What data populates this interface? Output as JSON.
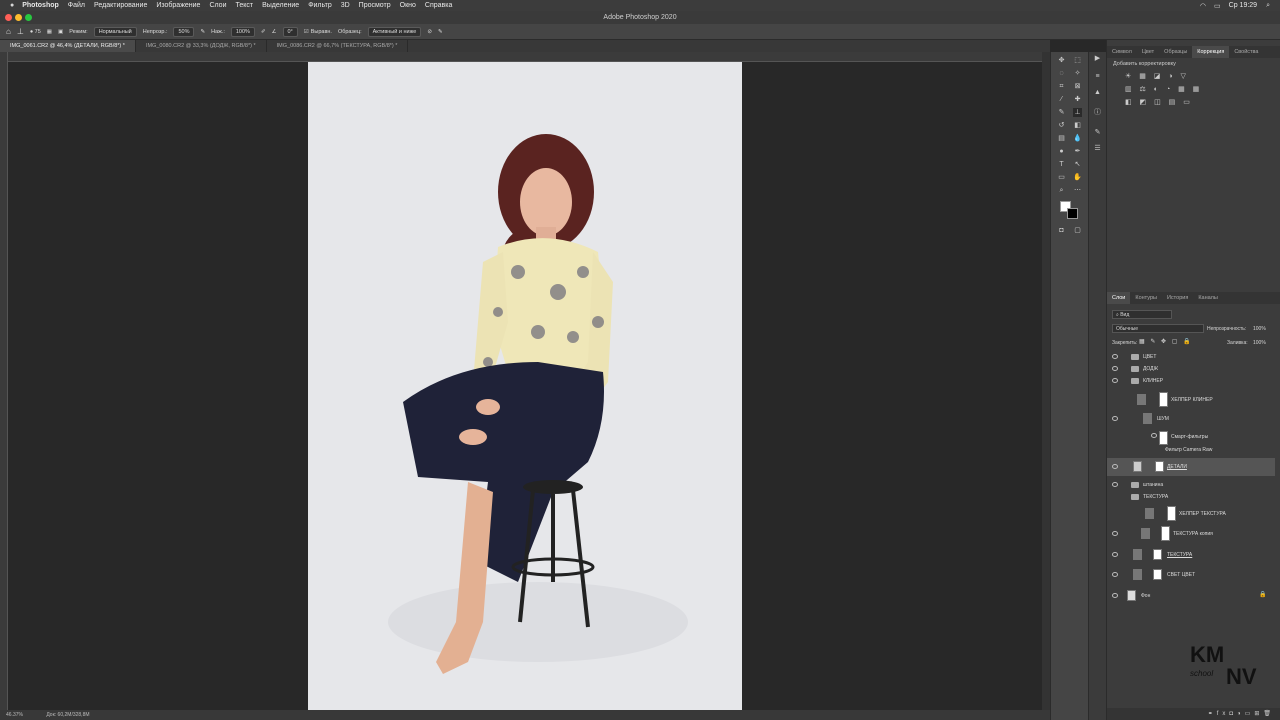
{
  "menubar": {
    "items": [
      "Photoshop",
      "Файл",
      "Редактирование",
      "Изображение",
      "Слои",
      "Текст",
      "Выделение",
      "Фильтр",
      "3D",
      "Просмотр",
      "Окно",
      "Справка"
    ],
    "clock": "Ср 19:29"
  },
  "title": "Adobe Photoshop 2020",
  "options": {
    "mode_label": "Режим:",
    "mode_value": "Нормальный",
    "opacity_label": "Непрозр.:",
    "opacity_value": "50%",
    "pressure_label": "Наж.:",
    "pressure_value": "100%",
    "angle_value": "0°",
    "aligned_label": "Выравн.",
    "sample_label": "Образец:",
    "sample_value": "Активный и ниже"
  },
  "tabs": [
    {
      "label": "IMG_0061.CR2 @ 46,4% (ДЕТАЛИ, RGB/8*) *",
      "active": true
    },
    {
      "label": "IMG_0080.CR2 @ 33,3% (ДОДЖ, RGB/8*) *",
      "active": false
    },
    {
      "label": "IMG_0086.CR2 @ 66,7% (ТЕКСТУРА, RGB/8*) *",
      "active": false
    }
  ],
  "status": {
    "zoom": "46.37%",
    "doc": "Док: 60,2M/328,8M"
  },
  "top_panel": {
    "tabs": [
      "Символ",
      "Цвет",
      "Образцы",
      "Коррекция",
      "Свойства"
    ],
    "active": "Коррекция",
    "hint": "Добавить корректировку"
  },
  "layers_panel": {
    "tabs": [
      "Слои",
      "Контуры",
      "История",
      "Каналы"
    ],
    "active": "Слои",
    "filter_kind": "Вид",
    "blend_mode": "Обычные",
    "opacity_label": "Непрозрачность:",
    "opacity_value": "100%",
    "lock_label": "Закрепить:",
    "fill_label": "Заливка:",
    "fill_value": "100%",
    "layers": [
      {
        "name": "ЦВЕТ",
        "kind": "folder"
      },
      {
        "name": "ДОДЖ",
        "kind": "folder"
      },
      {
        "name": "КЛИНЕР",
        "kind": "folder"
      },
      {
        "name": "ХЕЛПЕР КЛИНЕР",
        "kind": "layer"
      },
      {
        "name": "ШУМ",
        "kind": "smart"
      },
      {
        "name": "Смарт-фильтры",
        "kind": "filter"
      },
      {
        "name": "Фильтр Camera Raw",
        "kind": "filter"
      },
      {
        "name": "ДЕТАЛИ",
        "kind": "layer"
      },
      {
        "name": "штанина",
        "kind": "folder"
      },
      {
        "name": "ТЕКСТУРА",
        "kind": "folder"
      },
      {
        "name": "ХЕЛПЕР ТЕКСТУРА",
        "kind": "layer"
      },
      {
        "name": "ТЕКСТУРА копия",
        "kind": "layer"
      },
      {
        "name": "ТЕКСТУРА",
        "kind": "layer"
      },
      {
        "name": "СВЕТ ЦВЕТ",
        "kind": "layer"
      },
      {
        "name": "Фон",
        "kind": "background"
      }
    ]
  },
  "watermark": {
    "main": "KMNV",
    "sub": "school"
  }
}
